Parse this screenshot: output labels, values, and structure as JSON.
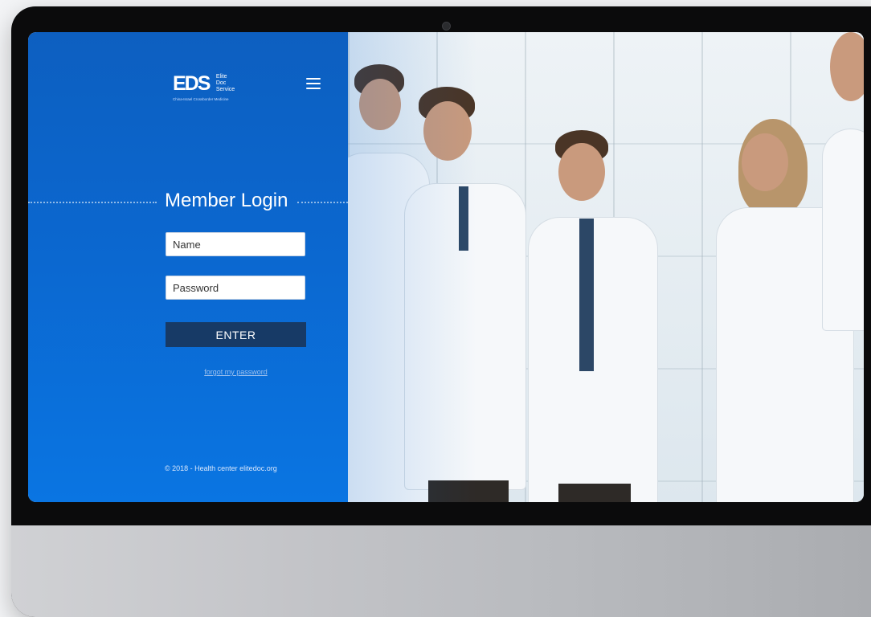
{
  "brand": {
    "mark": "EDS",
    "words": [
      "Elite",
      "Doc",
      "Service"
    ],
    "tagline": "China-Israel Crossborder Medicine"
  },
  "login": {
    "title": "Member Login",
    "name_placeholder": "Name",
    "password_placeholder": "Password",
    "enter_label": "ENTER",
    "forgot_label": "forgot my password"
  },
  "footer": {
    "text": "© 2018 - Health center elitedoc.org"
  },
  "colors": {
    "panel_blue": "#0b67cf",
    "button_navy": "#173a66"
  },
  "icons": {
    "menu": "hamburger-menu-icon"
  }
}
